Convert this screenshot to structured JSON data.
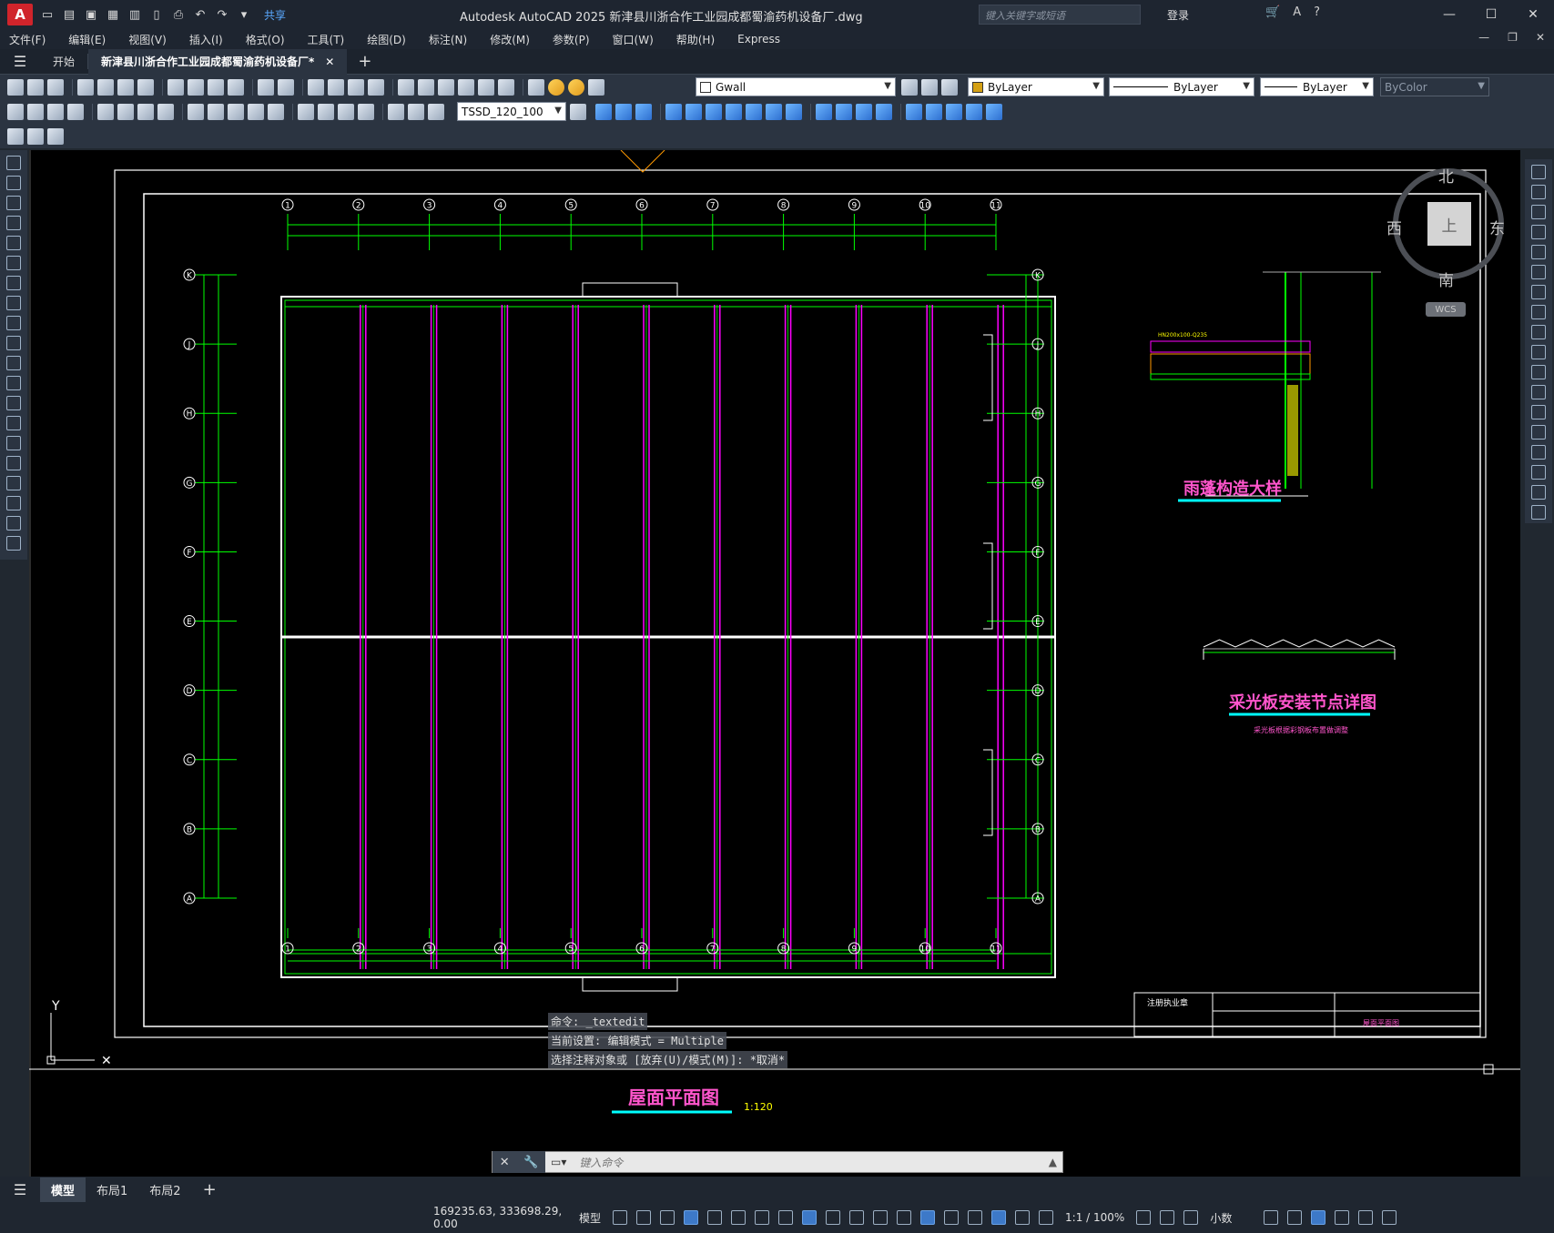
{
  "app": {
    "title": "Autodesk AutoCAD 2025    新津县川浙合作工业园成都蜀渝药机设备厂.dwg",
    "badge": "A",
    "share": "共享",
    "search_placeholder": "键入关键字或短语",
    "login": "登录"
  },
  "menu": [
    "文件(F)",
    "编辑(E)",
    "视图(V)",
    "插入(I)",
    "格式(O)",
    "工具(T)",
    "绘图(D)",
    "标注(N)",
    "修改(M)",
    "参数(P)",
    "窗口(W)",
    "帮助(H)",
    "Express"
  ],
  "tabs": {
    "start": "开始",
    "active": "新津县川浙合作工业园成都蜀渝药机设备厂*",
    "close": "✕",
    "plus": "+"
  },
  "toolbar": {
    "layer": "Gwall",
    "color": "ByLayer",
    "linetype": "ByLayer",
    "lineweight": "ByLayer",
    "plotstyle": "ByColor",
    "dimstyle": "TSSD_120_100"
  },
  "viewcube": {
    "top": "上",
    "north": "北",
    "south": "南",
    "west": "西",
    "east": "东",
    "wcs": "WCS"
  },
  "drawing": {
    "axis_numbers": [
      "1",
      "2",
      "3",
      "4",
      "5",
      "6",
      "7",
      "8",
      "9",
      "10",
      "11"
    ],
    "axis_letters": [
      "K",
      "J",
      "H",
      "G",
      "F",
      "E",
      "D",
      "C",
      "B",
      "A"
    ],
    "title_main": "屋面平面图",
    "scale": "1:120",
    "detail1": "雨蓬构造大样",
    "detail2": "采光板安装节点详图",
    "detail2_note": "采光板根据彩钢板布置做调整",
    "title_block_name": "屋面平面图",
    "title_block_label": "注册执业章"
  },
  "command": {
    "lines": [
      "命令: _textedit",
      "当前设置: 编辑模式 = Multiple",
      "选择注释对象或 [放弃(U)/模式(M)]: *取消*"
    ],
    "placeholder": "键入命令"
  },
  "layouts": [
    "模型",
    "布局1",
    "布局2"
  ],
  "status": {
    "coords": "169235.63, 333698.29, 0.00",
    "model": "模型",
    "scale": "1:1 / 100%",
    "units": "小数"
  },
  "colors": {
    "grid_green": "#00ff00",
    "purlin_magenta": "#ff00ff",
    "title_pink": "#ff55cc",
    "underline_cyan": "#00ffff"
  }
}
